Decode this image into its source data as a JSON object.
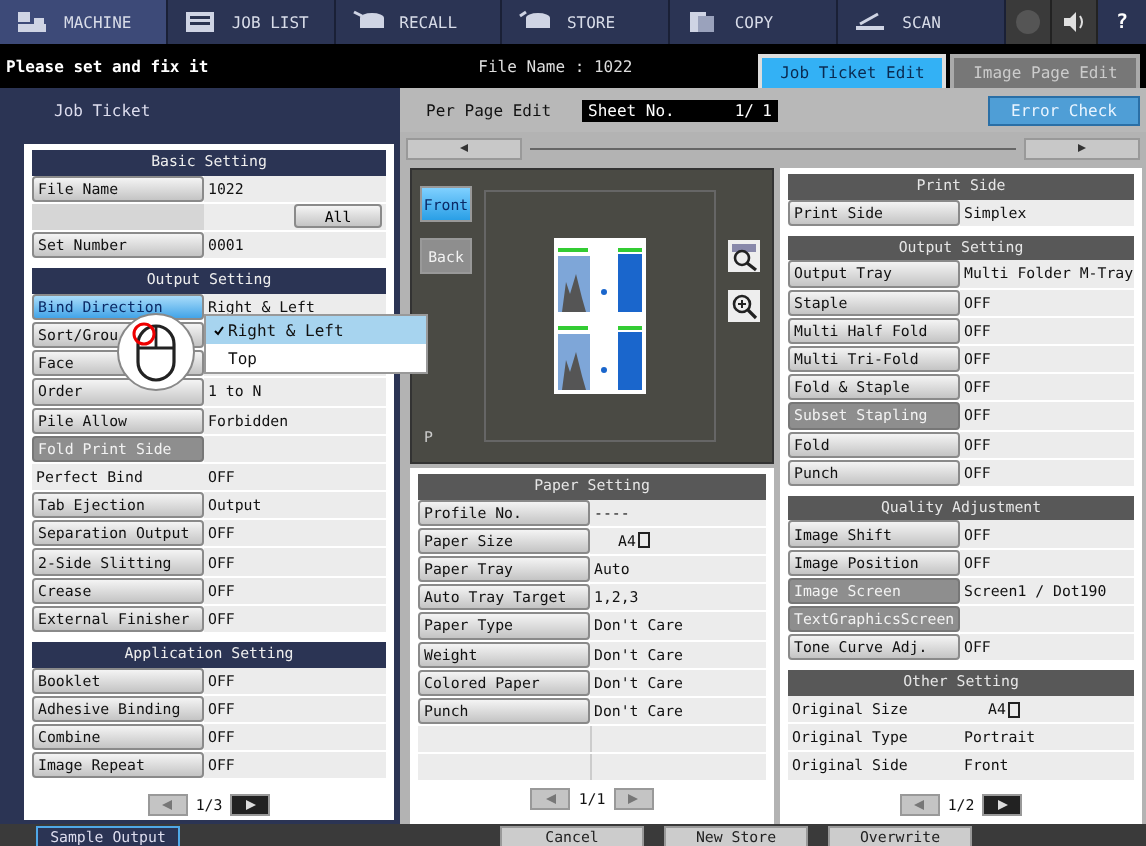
{
  "nav": [
    {
      "label": "MACHINE",
      "selected": true
    },
    {
      "label": "JOB LIST",
      "selected": false
    },
    {
      "label": "RECALL",
      "selected": false
    },
    {
      "label": "STORE",
      "selected": false
    },
    {
      "label": "COPY",
      "selected": false
    },
    {
      "label": "SCAN",
      "selected": false
    }
  ],
  "help": "?",
  "message": "Please set and fix it",
  "file_name": "File Name : 1022",
  "tabs": [
    {
      "label": "Job Ticket Edit",
      "selected": true
    },
    {
      "label": "Image Page Edit",
      "selected": false
    }
  ],
  "left_title": "Job Ticket",
  "per_page_edit": "Per Page Edit",
  "sheet": {
    "label": "Sheet No.",
    "current": "1/",
    "total": "1"
  },
  "error_check": "Error Check",
  "left_sections": [
    {
      "title": "Basic Setting",
      "rows": [
        {
          "kind": "button",
          "label": "File Name",
          "value": "1022",
          "selected": false,
          "disabled": false
        },
        {
          "kind": "action",
          "label": "All"
        },
        {
          "kind": "button",
          "label": "Set Number",
          "value": "0001",
          "selected": false,
          "disabled": false
        }
      ]
    },
    {
      "title": "Output Setting",
      "rows": [
        {
          "kind": "button",
          "label": "Bind Direction",
          "value": "Right & Left",
          "selected": true,
          "disabled": false
        },
        {
          "kind": "button",
          "label": "Sort/Grou",
          "selected": false,
          "disabled": false
        },
        {
          "kind": "button",
          "label": "Face",
          "selected": false,
          "disabled": false
        },
        {
          "kind": "button",
          "label": "Order",
          "value": "1 to N",
          "selected": false,
          "disabled": false
        },
        {
          "kind": "button",
          "label": "Pile Allow",
          "value": "Forbidden",
          "selected": false,
          "disabled": false
        },
        {
          "kind": "button",
          "label": "Fold Print Side",
          "selected": false,
          "disabled": true
        },
        {
          "kind": "plain",
          "label": "Perfect Bind",
          "value": "OFF"
        },
        {
          "kind": "button",
          "label": "Tab Ejection",
          "value": "Output",
          "selected": false,
          "disabled": false
        },
        {
          "kind": "button",
          "label": "Separation Output",
          "value": "OFF",
          "selected": false,
          "disabled": false
        },
        {
          "kind": "button",
          "label": "2-Side Slitting",
          "value": "OFF",
          "selected": false,
          "disabled": false
        },
        {
          "kind": "button",
          "label": "Crease",
          "value": "OFF",
          "selected": false,
          "disabled": false
        },
        {
          "kind": "button",
          "label": "External Finisher",
          "value": "OFF",
          "selected": false,
          "disabled": false
        }
      ]
    },
    {
      "title": "Application Setting",
      "rows": [
        {
          "kind": "button",
          "label": "Booklet",
          "value": "OFF",
          "selected": false,
          "disabled": false
        },
        {
          "kind": "button",
          "label": "Adhesive Binding",
          "value": "OFF",
          "selected": false,
          "disabled": false
        },
        {
          "kind": "button",
          "label": "Combine",
          "value": "OFF",
          "selected": false,
          "disabled": false
        },
        {
          "kind": "button",
          "label": "Image Repeat",
          "value": "OFF",
          "selected": false,
          "disabled": false
        }
      ]
    }
  ],
  "left_pager": {
    "page": "1/3",
    "prev_enabled": false,
    "next_enabled": true
  },
  "dropdown": [
    {
      "label": "Right & Left",
      "selected": true
    },
    {
      "label": "Top",
      "selected": false
    }
  ],
  "preview": {
    "sides": [
      {
        "label": "Front",
        "selected": true,
        "disabled": false
      },
      {
        "label": "Back",
        "selected": false,
        "disabled": true
      }
    ],
    "page_mark": "P"
  },
  "paper_section": {
    "title": "Paper Setting",
    "rows": [
      {
        "kind": "button",
        "label": "Profile No.",
        "value": "----",
        "selected": false,
        "disabled": false
      },
      {
        "kind": "size",
        "label": "Paper Size",
        "value": "A4",
        "selected": false,
        "disabled": false
      },
      {
        "kind": "button",
        "label": "Paper Tray",
        "value": "Auto",
        "selected": false,
        "disabled": false
      },
      {
        "kind": "button",
        "label": "Auto Tray Target",
        "value": "1,2,3",
        "selected": false,
        "disabled": false
      },
      {
        "kind": "button",
        "label": "Paper Type",
        "value": "Don't Care",
        "selected": false,
        "disabled": false
      },
      {
        "kind": "button",
        "label": "Weight",
        "value": "Don't Care",
        "selected": false,
        "disabled": false
      },
      {
        "kind": "button",
        "label": "Colored Paper",
        "value": "Don't Care",
        "selected": false,
        "disabled": false
      },
      {
        "kind": "button",
        "label": "Punch",
        "value": "Don't Care",
        "selected": false,
        "disabled": false
      }
    ]
  },
  "paper_pager": {
    "page": "1/1",
    "prev_enabled": false,
    "next_enabled": false
  },
  "right_sections": [
    {
      "title": "Print Side",
      "rows": [
        {
          "kind": "button",
          "label": "Print Side",
          "value": "Simplex",
          "selected": false,
          "disabled": false
        }
      ]
    },
    {
      "title": "Output Setting",
      "rows": [
        {
          "kind": "button",
          "label": "Output Tray",
          "value": "Multi Folder M-Tray",
          "selected": false,
          "disabled": false
        },
        {
          "kind": "button",
          "label": "Staple",
          "value": "OFF",
          "selected": false,
          "disabled": false
        },
        {
          "kind": "button",
          "label": "Multi Half Fold",
          "value": "OFF",
          "selected": false,
          "disabled": false
        },
        {
          "kind": "button",
          "label": "Multi Tri-Fold",
          "value": "OFF",
          "selected": false,
          "disabled": false
        },
        {
          "kind": "button",
          "label": "Fold & Staple",
          "value": "OFF",
          "selected": false,
          "disabled": false
        },
        {
          "kind": "button",
          "label": "Subset Stapling",
          "value": "OFF",
          "selected": false,
          "disabled": true
        },
        {
          "kind": "button",
          "label": "Fold",
          "value": "OFF",
          "selected": false,
          "disabled": false
        },
        {
          "kind": "button",
          "label": "Punch",
          "value": "OFF",
          "selected": false,
          "disabled": false
        }
      ]
    },
    {
      "title": "Quality Adjustment",
      "rows": [
        {
          "kind": "button",
          "label": "Image Shift",
          "value": "OFF",
          "selected": false,
          "disabled": false
        },
        {
          "kind": "button",
          "label": "Image Position",
          "value": "OFF",
          "selected": false,
          "disabled": false
        },
        {
          "kind": "button",
          "label": "Image Screen",
          "value": "Screen1 / Dot190",
          "selected": false,
          "disabled": true
        },
        {
          "kind": "button",
          "label": "TextGraphicsScreen",
          "selected": false,
          "disabled": true
        },
        {
          "kind": "button",
          "label": "Tone Curve Adj.",
          "value": "OFF",
          "selected": false,
          "disabled": false
        }
      ]
    },
    {
      "title": "Other Setting",
      "rows": [
        {
          "kind": "plainsize",
          "label": "Original Size",
          "value": "A4"
        },
        {
          "kind": "plain",
          "label": "Original Type",
          "value": "Portrait"
        },
        {
          "kind": "plain",
          "label": "Original Side",
          "value": "Front"
        }
      ]
    }
  ],
  "right_pager": {
    "page": "1/2",
    "prev_enabled": false,
    "next_enabled": true
  },
  "bottom_buttons": [
    {
      "label": "Sample Output",
      "highlighted": true
    },
    {
      "label": "Cancel",
      "highlighted": false
    },
    {
      "label": "New Store",
      "highlighted": false
    },
    {
      "label": "Overwrite",
      "highlighted": false
    }
  ]
}
